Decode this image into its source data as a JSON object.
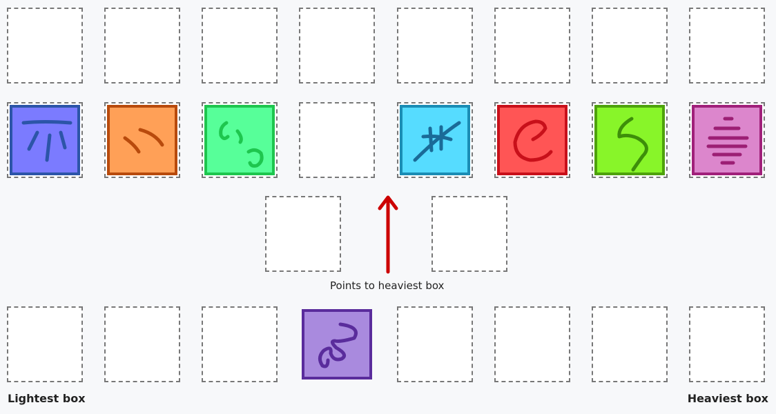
{
  "labels": {
    "lightest": "Lightest box",
    "heaviest": "Heaviest box",
    "arrow_caption": "Points to heaviest box"
  },
  "colors": {
    "arrow": "#cc0000"
  },
  "boxes": [
    {
      "name": "blue-box",
      "fill": "#7b7bff",
      "border": "#2c55a8",
      "ink": "#2c55a8"
    },
    {
      "name": "orange-box",
      "fill": "#ffa057",
      "border": "#b84a0c",
      "ink": "#b84a0c"
    },
    {
      "name": "green-box",
      "fill": "#57ff99",
      "border": "#1ec64e",
      "ink": "#1ec64e"
    },
    {
      "name": "cyan-box",
      "fill": "#56dcff",
      "border": "#1a8db5",
      "ink": "#1a6b98"
    },
    {
      "name": "red-box",
      "fill": "#ff5555",
      "border": "#c8101a",
      "ink": "#c8101a"
    },
    {
      "name": "lime-box",
      "fill": "#88f529",
      "border": "#4ea20c",
      "ink": "#3d8e0a"
    },
    {
      "name": "pink-box",
      "fill": "#dc86cc",
      "border": "#a0207a",
      "ink": "#9c1f74"
    },
    {
      "name": "purple-box",
      "fill": "#a98ade",
      "border": "#5a2c9c",
      "ink": "#5a2c9c"
    }
  ]
}
